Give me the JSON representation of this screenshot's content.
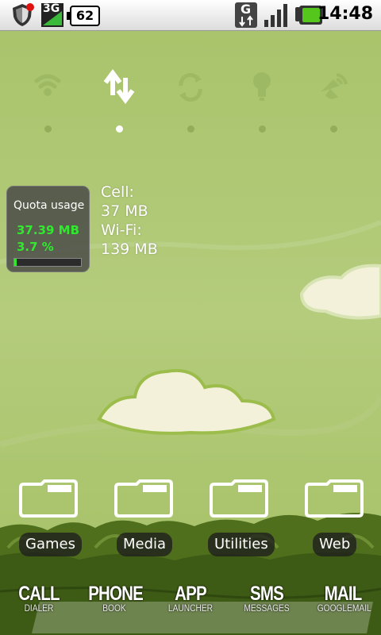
{
  "status_bar": {
    "network_type": "3G",
    "battery_level": "62",
    "data_indicator": "G",
    "time": "14:48"
  },
  "power_widget": {
    "items": [
      {
        "icon": "wifi-icon",
        "active": false
      },
      {
        "icon": "data-transfer-icon",
        "active": true
      },
      {
        "icon": "sync-icon",
        "active": false
      },
      {
        "icon": "brightness-bulb-icon",
        "active": false
      },
      {
        "icon": "gps-icon",
        "active": false
      }
    ]
  },
  "quota_widget": {
    "title": "Quota usage",
    "used": "37.39 MB",
    "percent": "3.7 %",
    "percent_value": 3.7
  },
  "usage": {
    "cell_label": "Cell:",
    "cell_value": "37 MB",
    "wifi_label": "Wi-Fi:",
    "wifi_value": "139 MB"
  },
  "folders": [
    {
      "label": "Games"
    },
    {
      "label": "Media"
    },
    {
      "label": "Utilities"
    },
    {
      "label": "Web"
    }
  ],
  "dock": [
    {
      "title": "CALL",
      "subtitle": "DIALER"
    },
    {
      "title": "PHONE",
      "subtitle": "BOOK"
    },
    {
      "title": "APP",
      "subtitle": "LAUNCHER"
    },
    {
      "title": "SMS",
      "subtitle": "MESSAGES"
    },
    {
      "title": "MAIL",
      "subtitle": "GOOGLEMAIL"
    }
  ],
  "colors": {
    "sky": "#a9c46b",
    "quota_green": "#31e82f"
  }
}
